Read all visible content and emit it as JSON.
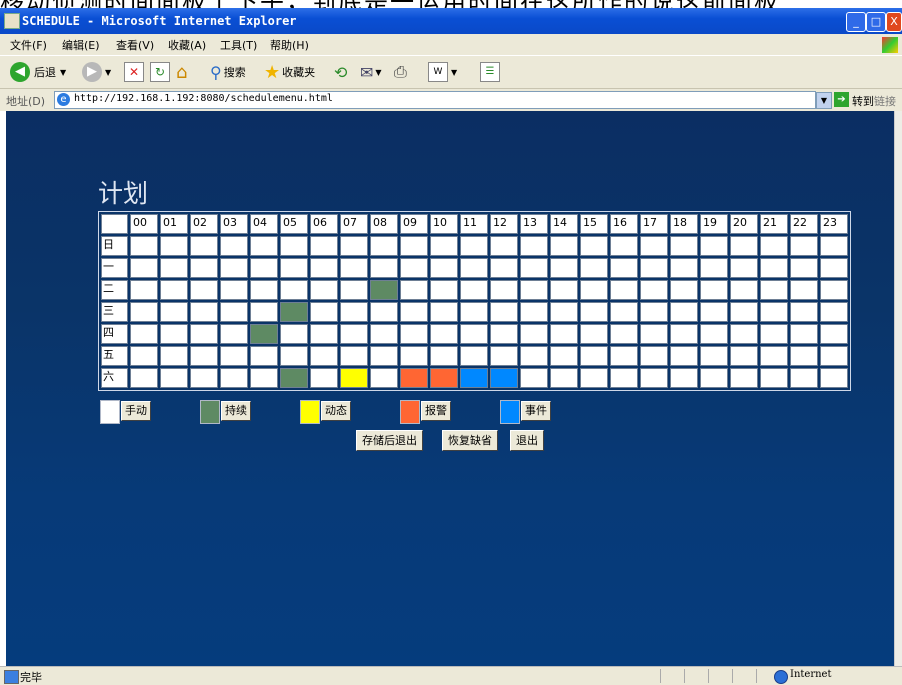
{
  "top_crop_text": "移动侦测时间面板上下午，到底是一运用时间在这所作的说这前面板",
  "window": {
    "title": "SCHEDULE - Microsoft Internet Explorer",
    "minimize": "_",
    "maximize": "□",
    "close": "X"
  },
  "menu": [
    "文件(F)",
    "编辑(E)",
    "查看(V)",
    "收藏(A)",
    "工具(T)",
    "帮助(H)"
  ],
  "toolbar": {
    "back": "后退",
    "search": "搜索",
    "favorites": "收藏夹"
  },
  "address": {
    "label": "地址(D)",
    "url": "http://192.168.1.192:8080/schedulemenu.html",
    "go": "转到",
    "links": "链接"
  },
  "page": {
    "title": "计划",
    "hours": [
      "00",
      "01",
      "02",
      "03",
      "04",
      "05",
      "06",
      "07",
      "08",
      "09",
      "10",
      "11",
      "12",
      "13",
      "14",
      "15",
      "16",
      "17",
      "18",
      "19",
      "20",
      "21",
      "22",
      "23"
    ],
    "days": [
      "日",
      "一",
      "二",
      "三",
      "四",
      "五",
      "六"
    ],
    "schedule": [
      [
        "",
        "",
        "",
        "",
        "",
        "",
        "",
        "",
        "",
        "",
        "",
        "",
        "",
        "",
        "",
        "",
        "",
        "",
        "",
        "",
        "",
        "",
        "",
        ""
      ],
      [
        "",
        "",
        "",
        "",
        "",
        "",
        "",
        "",
        "",
        "",
        "",
        "",
        "",
        "",
        "",
        "",
        "",
        "",
        "",
        "",
        "",
        "",
        "",
        ""
      ],
      [
        "",
        "",
        "",
        "",
        "",
        "",
        "",
        "",
        "c",
        "",
        "",
        "",
        "",
        "",
        "",
        "",
        "",
        "",
        "",
        "",
        "",
        "",
        "",
        ""
      ],
      [
        "",
        "",
        "",
        "",
        "",
        "c",
        "",
        "",
        "",
        "",
        "",
        "",
        "",
        "",
        "",
        "",
        "",
        "",
        "",
        "",
        "",
        "",
        "",
        ""
      ],
      [
        "",
        "",
        "",
        "",
        "c",
        "",
        "",
        "",
        "",
        "",
        "",
        "",
        "",
        "",
        "",
        "",
        "",
        "",
        "",
        "",
        "",
        "",
        "",
        ""
      ],
      [
        "",
        "",
        "",
        "",
        "",
        "",
        "",
        "",
        "",
        "",
        "",
        "",
        "",
        "",
        "",
        "",
        "",
        "",
        "",
        "",
        "",
        "",
        "",
        ""
      ],
      [
        "",
        "",
        "",
        "",
        "",
        "c",
        "",
        "d",
        "",
        "a",
        "a",
        "e",
        "e",
        "",
        "",
        "",
        "",
        "",
        "",
        "",
        "",
        "",
        "",
        ""
      ]
    ],
    "modes": {
      "m": {
        "label": "手动",
        "color": "#ffffff"
      },
      "c": {
        "label": "持续",
        "color": "#5e8a63"
      },
      "d": {
        "label": "动态",
        "color": "#ffff00"
      },
      "a": {
        "label": "报警",
        "color": "#ff6633"
      },
      "e": {
        "label": "事件",
        "color": "#0088ff"
      }
    },
    "actions": {
      "save_exit": "存储后退出",
      "restore_default": "恢复缺省",
      "exit": "退出"
    }
  },
  "status": {
    "text": "完毕",
    "zone": "Internet"
  }
}
